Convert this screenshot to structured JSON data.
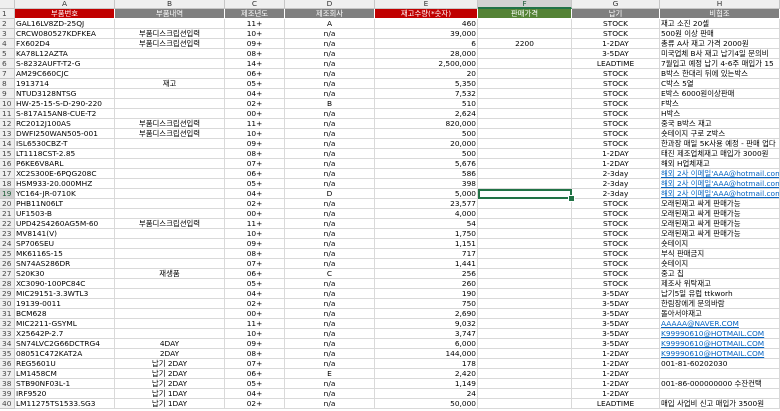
{
  "columns": [
    "A",
    "B",
    "C",
    "D",
    "E",
    "F",
    "G",
    "H"
  ],
  "selected_column": "F",
  "selected_row": "19",
  "header_colors": {
    "default": "#7f7f7f",
    "A": "#c00000",
    "B": "#7f7f7f",
    "C": "#7f7f7f",
    "D": "#7f7f7f",
    "E": "#c00000",
    "F": "#548235",
    "G": "#7f7f7f",
    "H": "#7f7f7f"
  },
  "rows": [
    {
      "n": "1",
      "c": [
        "부품번호",
        "부품내역",
        "제조년도",
        "제조회사",
        "재고수량(*숫자)",
        "판매가격",
        "납기",
        "비협조"
      ]
    },
    {
      "n": "2",
      "c": [
        "GAL16LV8ZD-25QJ",
        "",
        "11+",
        "A",
        "460",
        "",
        "STOCK",
        "재고 소진 20셀"
      ]
    },
    {
      "n": "3",
      "c": [
        "CRCW080527KDFKEA",
        "부품디스크립션입력",
        "10+",
        "n/a",
        "39,000",
        "",
        "STOCK",
        "500원 이상 판매"
      ]
    },
    {
      "n": "4",
      "c": [
        "FX602D4",
        "부품디스크립션입력",
        "09+",
        "n/a",
        "6",
        "2200",
        "1-2DAY",
        "총류 A사 재고 가격 2000원"
      ]
    },
    {
      "n": "5",
      "c": [
        "KA78L12AZTA",
        "",
        "08+",
        "n/a",
        "28,000",
        "",
        "3-5DAY",
        "미국업체 B사 재고 납기4일 문의비"
      ]
    },
    {
      "n": "6",
      "c": [
        "S-8232AUFT-T2-G",
        "",
        "14+",
        "n/a",
        "2,500,000",
        "",
        "LEADTIME",
        "7월입고 예정 납기 4-6주 매입가 15"
      ]
    },
    {
      "n": "7",
      "c": [
        "AM29C660CJC",
        "",
        "06+",
        "n/a",
        "20",
        "",
        "STOCK",
        "B박스 한대리 뒤에 있는박스"
      ]
    },
    {
      "n": "8",
      "c": [
        "1913714",
        "재고",
        "05+",
        "n/a",
        "5,350",
        "",
        "STOCK",
        "C박스 5열"
      ]
    },
    {
      "n": "9",
      "c": [
        "NTUD3128NTSG",
        "",
        "04+",
        "n/a",
        "7,532",
        "",
        "STOCK",
        "E박스 6000원이상판매"
      ]
    },
    {
      "n": "10",
      "c": [
        "HW-25-15-S-D-290-220",
        "",
        "02+",
        "B",
        "510",
        "",
        "STOCK",
        "F박스"
      ]
    },
    {
      "n": "11",
      "c": [
        "S-817A15AN8-CUE-T2",
        "",
        "00+",
        "n/a",
        "2,624",
        "",
        "STOCK",
        "H박스"
      ]
    },
    {
      "n": "12",
      "c": [
        "RC2012J100AS",
        "부품디스크립션입력",
        "11+",
        "n/a",
        "820,000",
        "",
        "STOCK",
        "중국 B박스 재고"
      ]
    },
    {
      "n": "13",
      "c": [
        "DWFI250WAN505-001",
        "부품디스크립션입력",
        "10+",
        "n/a",
        "500",
        "",
        "STOCK",
        "숏테이지 구로 Z박스"
      ]
    },
    {
      "n": "14",
      "c": [
        "ISL6530CBZ-T",
        "",
        "09+",
        "n/a",
        "20,000",
        "",
        "STOCK",
        "한과장 매일 5K사용 예정 - 판매 업다"
      ]
    },
    {
      "n": "15",
      "c": [
        "LT1118CST-2.85",
        "",
        "08+",
        "n/a",
        "500",
        "",
        "1-2DAY",
        "태진 제조업체재고 매입가 3000원"
      ]
    },
    {
      "n": "16",
      "c": [
        "P6KE6V8ARL",
        "",
        "07+",
        "n/a",
        "5,676",
        "",
        "1-2DAY",
        "해외 H업체재고"
      ]
    },
    {
      "n": "17",
      "c": [
        "XC2S300E-6PQG208C",
        "",
        "06+",
        "n/a",
        "586",
        "",
        "2-3day",
        "해외 2사 이메일'AAA@hotmail.com"
      ]
    },
    {
      "n": "18",
      "c": [
        "HSM933-20.000MHZ",
        "",
        "05+",
        "n/a",
        "398",
        "",
        "2-3day",
        "해외 2사 이메일'AAA@hotmail.com"
      ]
    },
    {
      "n": "19",
      "c": [
        "YC164-JR-0710K",
        "",
        "04+",
        "D",
        "5,000",
        "",
        "2-3day",
        "해외 2사 이메일'AAA@hotmail.com"
      ]
    },
    {
      "n": "20",
      "c": [
        "PHB11N06LT",
        "",
        "02+",
        "n/a",
        "23,577",
        "",
        "STOCK",
        "오래된재고 싸게 판매가능"
      ]
    },
    {
      "n": "21",
      "c": [
        "UF1503-B",
        "",
        "00+",
        "n/a",
        "4,000",
        "",
        "STOCK",
        "오래된재고 싸게 판매가능"
      ]
    },
    {
      "n": "22",
      "c": [
        "UPD42S4260AG5M-60",
        "부품디스크립션입력",
        "11+",
        "n/a",
        "54",
        "",
        "STOCK",
        "오래된재고 싸게 판매가능"
      ]
    },
    {
      "n": "23",
      "c": [
        "MV8141(V)",
        "",
        "10+",
        "n/a",
        "1,750",
        "",
        "STOCK",
        "오래된재고 싸게 판매가능"
      ]
    },
    {
      "n": "24",
      "c": [
        "SP706SEU",
        "",
        "09+",
        "n/a",
        "1,151",
        "",
        "STOCK",
        "숏테이지"
      ]
    },
    {
      "n": "25",
      "c": [
        "MK6116S-15",
        "",
        "08+",
        "n/a",
        "717",
        "",
        "STOCK",
        "부식 판매금지"
      ]
    },
    {
      "n": "26",
      "c": [
        "SN74AS286DR",
        "",
        "07+",
        "n/a",
        "1,441",
        "",
        "STOCK",
        "숏테이지"
      ]
    },
    {
      "n": "27",
      "c": [
        "S20K30",
        "재생품",
        "06+",
        "C",
        "256",
        "",
        "STOCK",
        "중고 칩"
      ]
    },
    {
      "n": "28",
      "c": [
        "XC3090-100PC84C",
        "",
        "05+",
        "n/a",
        "260",
        "",
        "STOCK",
        "제조사 위탁재고"
      ]
    },
    {
      "n": "29",
      "c": [
        "MIC29151-3.3WTL3",
        "",
        "04+",
        "n/a",
        "190",
        "",
        "3-5DAY",
        "납기5일 유럽 ttkworh"
      ]
    },
    {
      "n": "30",
      "c": [
        "19139-0011",
        "",
        "02+",
        "n/a",
        "750",
        "",
        "3-5DAY",
        "한림장에게 문의바람"
      ]
    },
    {
      "n": "31",
      "c": [
        "BCM628",
        "",
        "00+",
        "n/a",
        "2,690",
        "",
        "3-5DAY",
        "돌아서야재고"
      ]
    },
    {
      "n": "32",
      "c": [
        "MIC2211-GSYML",
        "",
        "11+",
        "n/a",
        "9,032",
        "",
        "3-5DAY",
        "AAAAA@NAVER.COM"
      ]
    },
    {
      "n": "33",
      "c": [
        "X25642P-2.7",
        "",
        "10+",
        "n/a",
        "3,747",
        "",
        "3-5DAY",
        "K99990610@HOTMAIL.COM"
      ]
    },
    {
      "n": "34",
      "c": [
        "SN74LVC2G66DCTRG4",
        "4DAY",
        "09+",
        "n/a",
        "6,000",
        "",
        "3-5DAY",
        "K99990610@HOTMAIL.COM"
      ]
    },
    {
      "n": "35",
      "c": [
        "08051C472KAT2A",
        "2DAY",
        "08+",
        "n/a",
        "144,000",
        "",
        "1-2DAY",
        "K99990610@HOTMAIL.COM"
      ]
    },
    {
      "n": "36",
      "c": [
        "REG5601U",
        "납기 2DAY",
        "07+",
        "n/a",
        "178",
        "",
        "1-2DAY",
        "001-81-60202030"
      ]
    },
    {
      "n": "37",
      "c": [
        "LM1458CM",
        "납기 2DAY",
        "06+",
        "E",
        "2,420",
        "",
        "1-2DAY",
        ""
      ]
    },
    {
      "n": "38",
      "c": [
        "STB90NF03L-1",
        "납기 2DAY",
        "05+",
        "n/a",
        "1,149",
        "",
        "1-2DAY",
        "001-86-000000000 수잔컨택"
      ]
    },
    {
      "n": "39",
      "c": [
        "IRF9520",
        "납기 1DAY",
        "04+",
        "n/a",
        "24",
        "",
        "1-2DAY",
        ""
      ]
    },
    {
      "n": "40",
      "c": [
        "LM11275TS1533.SG3",
        "납기 1DAY",
        "02+",
        "n/a",
        "50,000",
        "",
        "LEADTIME",
        "매입 사업비 신고 매입가 3500원"
      ]
    }
  ]
}
